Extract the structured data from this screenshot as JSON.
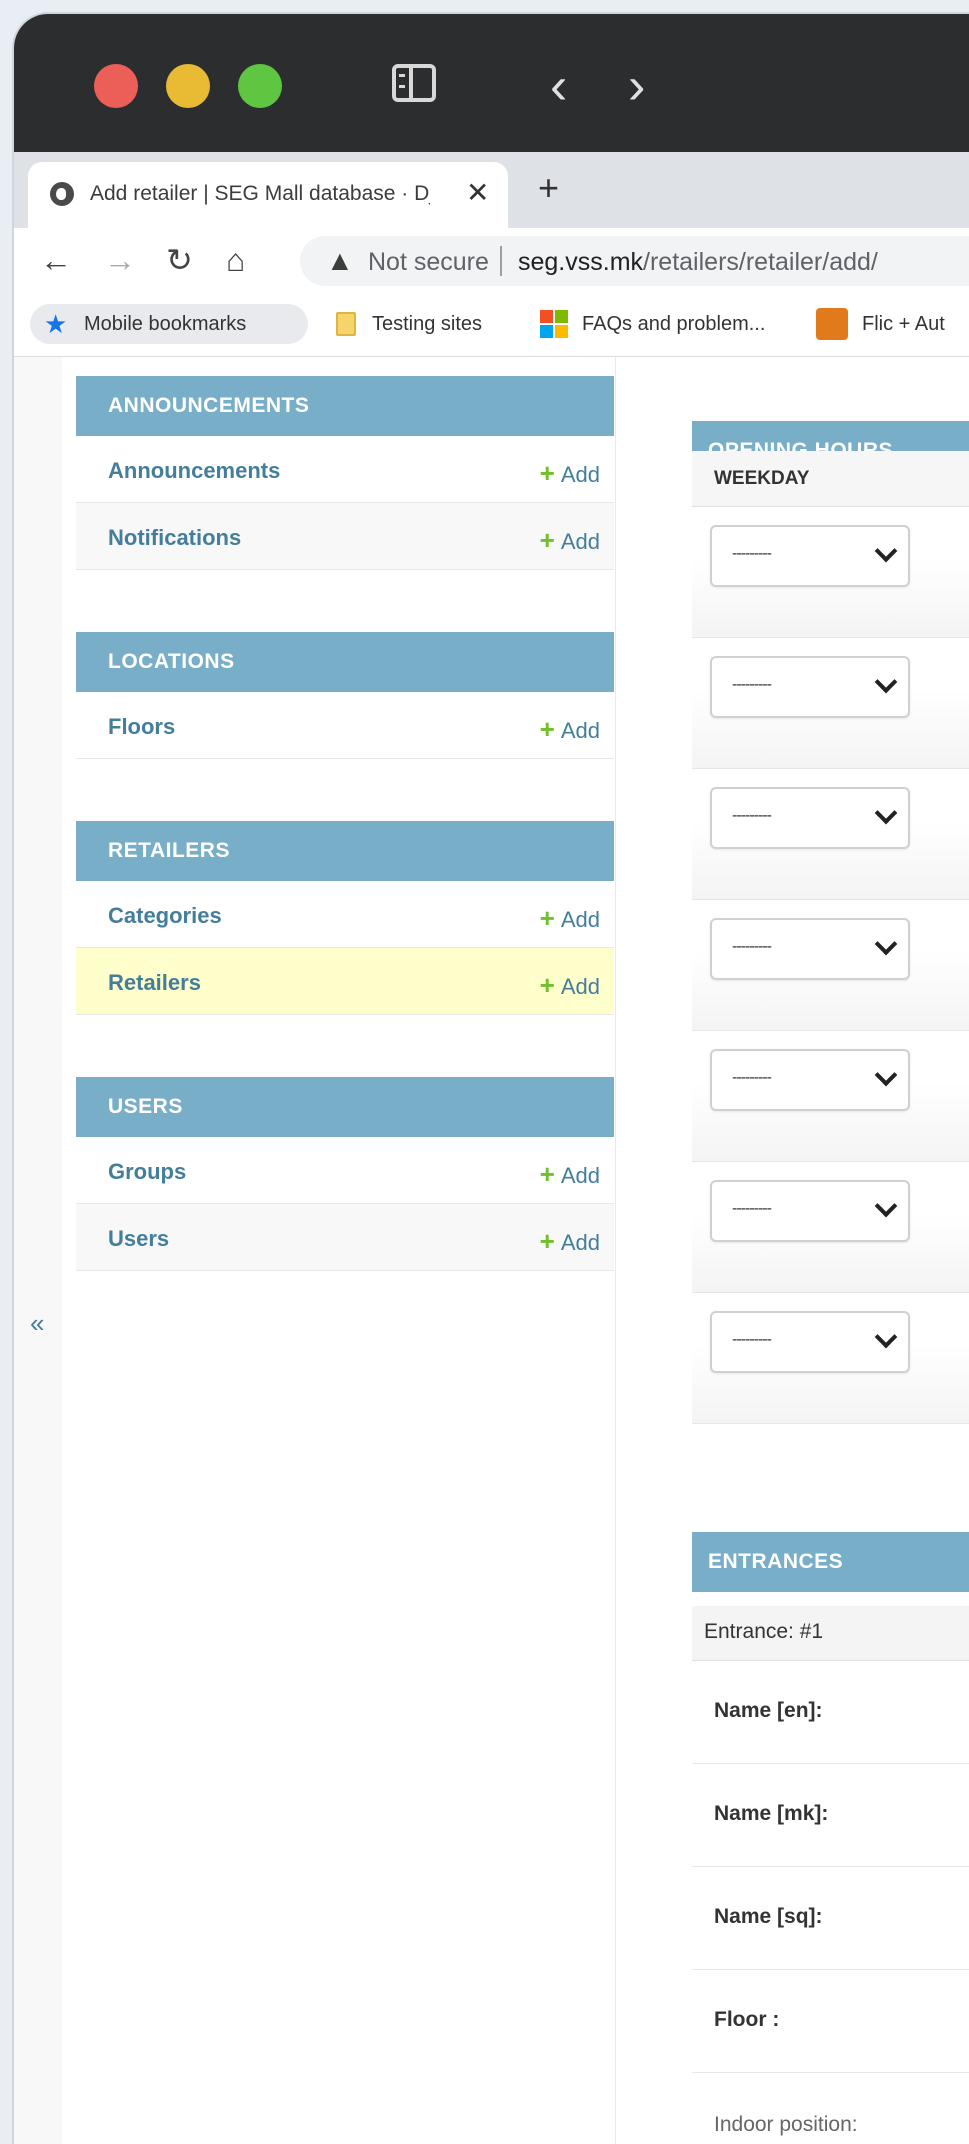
{
  "browser": {
    "tab_title": "Add retailer | SEG Mall database · Django site admin",
    "tab_close": "✕",
    "new_tab": "+",
    "security_label": "Not secure",
    "url_host": "seg.vss.mk",
    "url_path": "/retailers/retailer/add/",
    "bookmarks": [
      {
        "label": "Mobile bookmarks",
        "icon": "star-icon"
      },
      {
        "label": "Testing sites",
        "icon": "folder-icon"
      },
      {
        "label": "FAQs and problem...",
        "icon": "microsoft-icon"
      },
      {
        "label": "Flic + Aut",
        "icon": "flic-icon"
      }
    ]
  },
  "sidebar": {
    "collapse_label": "«",
    "modules": [
      {
        "caption": "ANNOUNCEMENTS",
        "rows": [
          {
            "label": "Announcements",
            "add": "Add"
          },
          {
            "label": "Notifications",
            "add": "Add"
          }
        ]
      },
      {
        "caption": "LOCATIONS",
        "rows": [
          {
            "label": "Floors",
            "add": "Add"
          }
        ]
      },
      {
        "caption": "RETAILERS",
        "rows": [
          {
            "label": "Categories",
            "add": "Add"
          },
          {
            "label": "Retailers",
            "add": "Add",
            "current": true
          }
        ]
      },
      {
        "caption": "USERS",
        "rows": [
          {
            "label": "Groups",
            "add": "Add"
          },
          {
            "label": "Users",
            "add": "Add"
          }
        ]
      }
    ]
  },
  "main": {
    "opening_hours": {
      "caption": "OPENING HOURS",
      "column_header": "WEEKDAY",
      "weekday_placeholder": "---------",
      "row_count": 7
    },
    "entrances": {
      "caption": "ENTRANCES",
      "entrance_title": "Entrance: #1",
      "fields": [
        "Name [en]:",
        "Name [mk]:",
        "Name [sq]:",
        "Floor :",
        "Indoor position:"
      ]
    }
  },
  "colors": {
    "module_header": "#79aec8",
    "link": "#447e9b",
    "add_plus": "#70bf2b",
    "current_row": "#ffffcc"
  }
}
